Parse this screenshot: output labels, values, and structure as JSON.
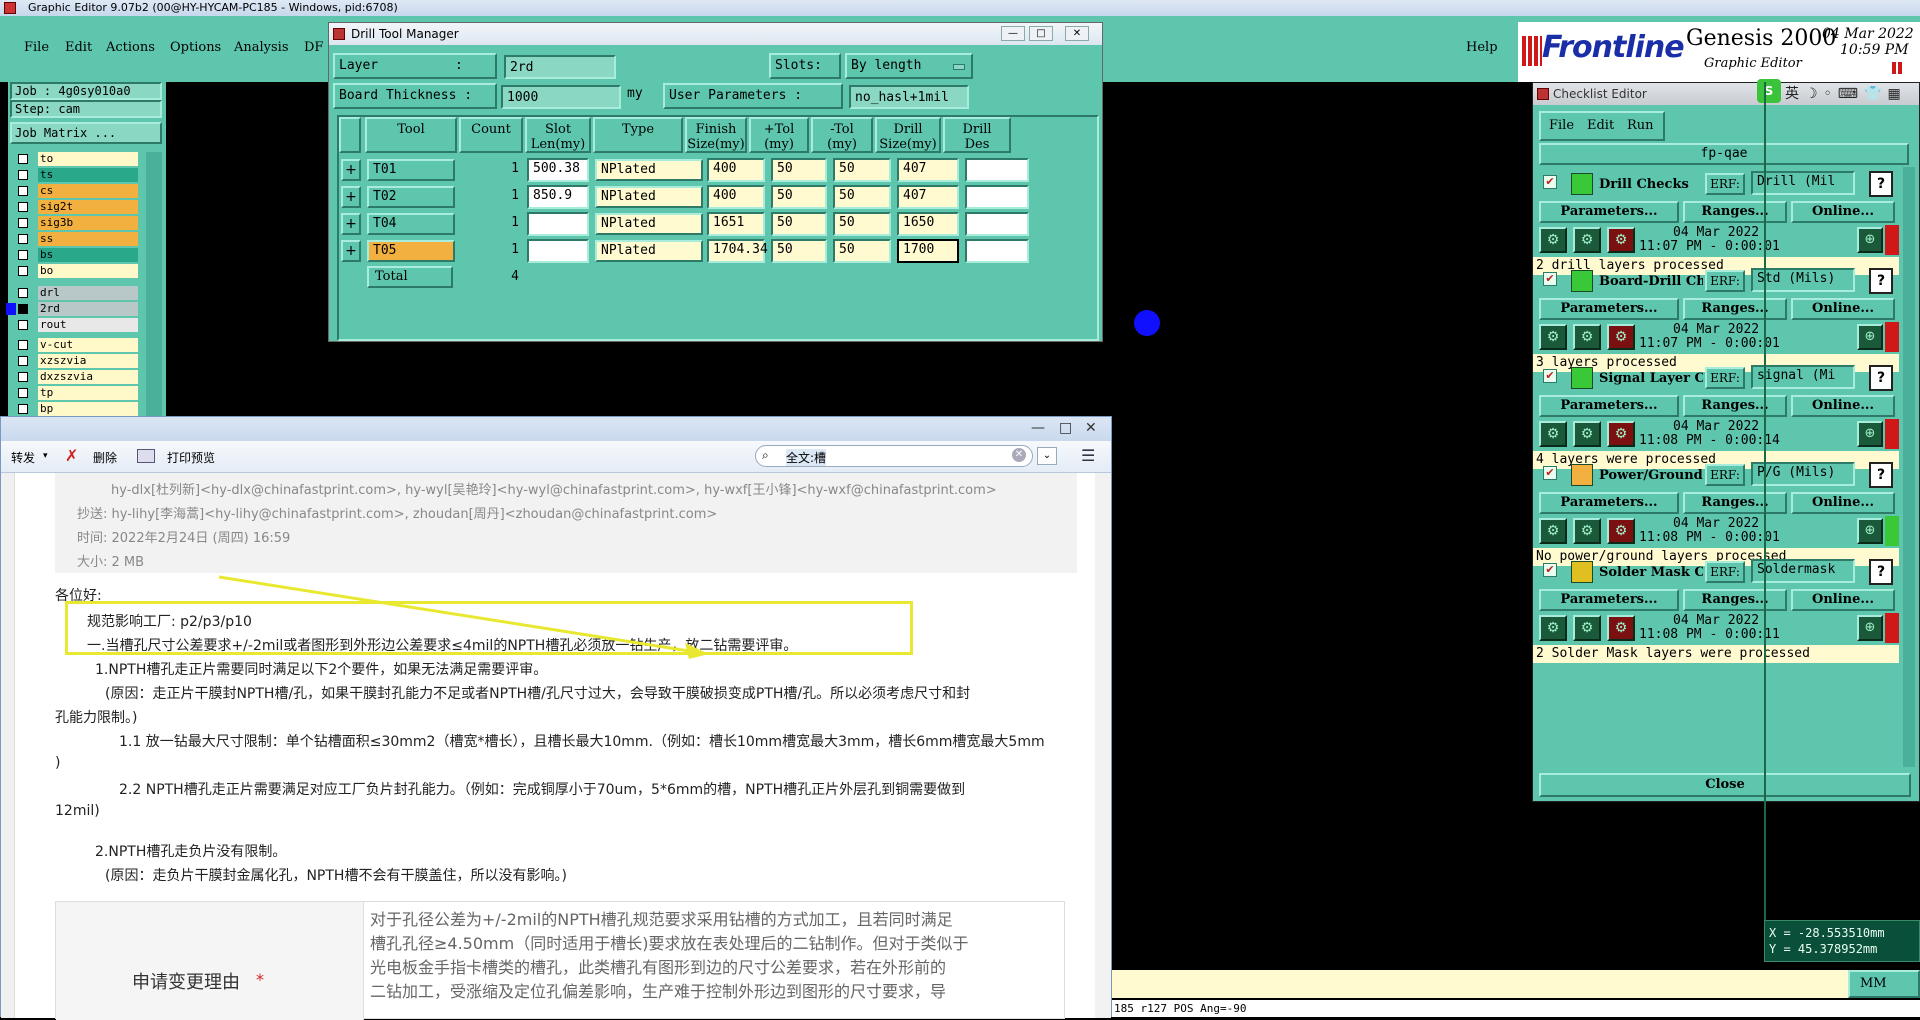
{
  "app": {
    "title": "Graphic Editor 9.07b2 (00@HY-HYCAM-PC185 - Windows, pid:6708)"
  },
  "menubar": {
    "items": [
      "File",
      "Edit",
      "Actions",
      "Options",
      "Analysis",
      "DF"
    ],
    "help": "Help"
  },
  "job": {
    "job": "Job : 4g0sy010a0",
    "step": "Step: cam",
    "matrix_button": "Job Matrix ..."
  },
  "layers": [
    {
      "name": "to",
      "color": "#fff8c8"
    },
    {
      "name": "ts",
      "color": "#2aa88a"
    },
    {
      "name": "cs",
      "color": "#f2b040"
    },
    {
      "name": "sig2t",
      "color": "#f2b040"
    },
    {
      "name": "sig3b",
      "color": "#f2b040"
    },
    {
      "name": "ss",
      "color": "#f2b040"
    },
    {
      "name": "bs",
      "color": "#2aa88a"
    },
    {
      "name": "bo",
      "color": "#fff8c8"
    },
    {
      "name": "drl",
      "color": "#b8c8c8"
    },
    {
      "name": "2rd",
      "color": "#b8c8c8"
    },
    {
      "name": "rout",
      "color": "#e8e8e8"
    },
    {
      "name": "v-cut",
      "color": "#fff8c8"
    },
    {
      "name": "xzszvia",
      "color": "#fff8c8"
    },
    {
      "name": "dxzszvia",
      "color": "#fff8c8"
    },
    {
      "name": "tp",
      "color": "#fff8c8"
    },
    {
      "name": "bp",
      "color": "#fff8c8"
    }
  ],
  "drill_tool_manager": {
    "title": "Drill Tool Manager",
    "layer_label": "Layer",
    "layer_sep": ":",
    "layer_value": "2rd",
    "slots_label": "Slots:",
    "slots_value": "By length",
    "thickness_label": "Board Thickness  :",
    "thickness_value": "1000",
    "thickness_unit": "my",
    "user_params_label": "User Parameters  :",
    "user_params_value": "no_hasl+1mil",
    "headers": [
      "Tool",
      "Count",
      "Slot\nLen(my)",
      "Type",
      "Finish\nSize(my)",
      "+Tol\n(my)",
      "-Tol\n(my)",
      "Drill\nSize(my)",
      "Drill\nDes"
    ],
    "rows": [
      {
        "tool": "T01",
        "count": "1",
        "slot_len": "500.38",
        "type": "NPlated",
        "finish": "400",
        "ptol": "50",
        "ntol": "50",
        "drill": "407",
        "des": ""
      },
      {
        "tool": "T02",
        "count": "1",
        "slot_len": "850.9",
        "type": "NPlated",
        "finish": "400",
        "ptol": "50",
        "ntol": "50",
        "drill": "407",
        "des": ""
      },
      {
        "tool": "T04",
        "count": "1",
        "slot_len": "",
        "type": "NPlated",
        "finish": "1651",
        "ptol": "50",
        "ntol": "50",
        "drill": "1650",
        "des": ""
      },
      {
        "tool": "T05",
        "count": "1",
        "slot_len": "",
        "type": "NPlated",
        "finish": "1704.34",
        "ptol": "50",
        "ntol": "50",
        "drill": "1700",
        "des": ""
      }
    ],
    "total_label": "Total",
    "total_count": "4"
  },
  "mail": {
    "toolbar": {
      "forward": "转发",
      "delete": "删除",
      "print": "打印预览",
      "search": "全文:槽"
    },
    "header_lines": [
      "hy-dlx[杜列新]<hy-dlx@chinafastprint.com>, hy-wyl[吴艳玲]<hy-wyl@chinafastprint.com>, hy-wxf[王小锋]<hy-wxf@chinafastprint.com>",
      "抄送: hy-lihy[李海蒿]<hy-lihy@chinafastprint.com>, zhoudan[周丹]<zhoudan@chinafastprint.com>",
      "时间: 2022年2月24日 (周四) 16:59",
      "大小: 2 MB"
    ],
    "greeting": "各位好:",
    "scope": "规范影响工厂: p2/p3/p10",
    "line1": "一.当槽孔尺寸公差要求+/-2mil或者图形到外形边公差要求≤4mil的NPTH槽孔必须放一钻生产，放二钻需要评审。",
    "line2": "1.NPTH槽孔走正片需要同时满足以下2个要件，如果无法满足需要评审。",
    "line3": "(原因：走正片干膜封NPTH槽/孔，如果干膜封孔能力不足或者NPTH槽/孔尺寸过大，会导致干膜破损变成PTH槽/孔。所以必须考虑尺寸和封",
    "line3b": "孔能力限制。)",
    "line4": "1.1 放一钻最大尺寸限制：单个钻槽面积≤30mm2（槽宽*槽长），且槽长最大10mm.（例如：槽长10mm槽宽最大3mm，槽长6mm槽宽最大5mm",
    "line4b": ")",
    "line5": "2.2 NPTH槽孔走正片需要满足对应工厂负片封孔能力。（例如：完成铜厚小于70um，5*6mm的槽，NPTH槽孔正片外层孔到铜需要做到",
    "line5b": "12mil)",
    "line6": "2.NPTH槽孔走负片没有限制。",
    "line7": "(原因：走负片干膜封金属化孔，NPTH槽不会有干膜盖住，所以没有影响。)",
    "reason_label": "申请变更理由",
    "reason_star": "*",
    "reason_text": [
      "对于孔径公差为+/-2mil的NPTH槽孔规范要求采用钻槽的方式加工，且若同时满足",
      "槽孔孔径≥4.50mm（同时适用于槽长)要求放在表处理后的二钻制作。但对于类似于",
      "光电板金手指卡槽类的槽孔，此类槽孔有图形到边的尺寸公差要求，若在外形前的",
      "二钻加工，受涨缩及定位孔偏差影响，生产难于控制外形边到图形的尺寸要求，导"
    ]
  },
  "frontline": {
    "logo": "Frontline",
    "product": "Genesis 2000",
    "subtitle": "Graphic Editor",
    "date": "04 Mar 2022",
    "time": "10:59 PM"
  },
  "checklist": {
    "title": "Checklist Editor",
    "menu": [
      "File",
      "Edit",
      "Run"
    ],
    "name": "fp-qae",
    "erf_label": "ERF:",
    "params_label": "Parameters...",
    "ranges_label": "Ranges...",
    "online_label": "Online...",
    "close_label": "Close",
    "items": [
      {
        "name": "Drill Checks",
        "erf": "Drill (Mil",
        "date": "04 Mar 2022",
        "time": "11:07 PM - 0:00:01",
        "status": "2 drill layers processed",
        "state_color": "#d01818"
      },
      {
        "name": "Board-Drill Che",
        "erf": "Std (Mils)",
        "date": "04 Mar 2022",
        "time": "11:07 PM - 0:00:01",
        "status": "3 layers processed",
        "state_color": "#d01818"
      },
      {
        "name": "Signal Layer Ch",
        "erf": "signal (Mi",
        "date": "04 Mar 2022",
        "time": "11:08 PM - 0:00:14",
        "status": "4 layers were processed",
        "state_color": "#d01818"
      },
      {
        "name": "Power/Ground C",
        "erf": "P/G (Mils)",
        "date": "04 Mar 2022",
        "time": "11:08 PM - 0:00:01",
        "status": "No power/ground layers processed",
        "state_color": "#38c838"
      },
      {
        "name": "Solder Mask Ch",
        "erf": "Soldermask",
        "date": "04 Mar 2022",
        "time": "11:08 PM - 0:00:11",
        "status": "2 Solder Mask layers were processed",
        "state_color": "#d01818"
      }
    ]
  },
  "coords": {
    "x": "X = -28.553510mm",
    "y": "Y = 45.378952mm",
    "unit": "MM"
  },
  "statusbar": {
    "text": "185 r127 POS Ang=-90"
  },
  "colors": {
    "panel": "#5fc6ae",
    "highlight": "#fff37a",
    "blue_dot": "#1010ff"
  }
}
